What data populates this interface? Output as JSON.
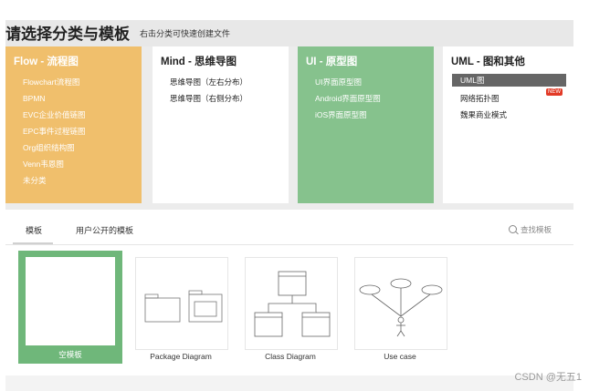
{
  "header": {
    "title": "请选择分类与模板",
    "subtitle": "右击分类可快速创建文件"
  },
  "categories": [
    {
      "title": "Flow - 流程图",
      "items": [
        "Flowchart流程图",
        "BPMN",
        "EVC企业价值链图",
        "EPC事件过程链图",
        "Org组织结构图",
        "Venn韦恩图",
        "未分类"
      ]
    },
    {
      "title": "Mind - 思维导图",
      "items": [
        "思维导图（左右分布）",
        "思维导图（右侧分布）"
      ]
    },
    {
      "title": "UI - 原型图",
      "items": [
        "UI界面原型图",
        "Android界面原型图",
        "iOS界面原型图"
      ]
    },
    {
      "title": "UML - 图和其他",
      "items": [
        "UML图",
        "网络拓扑图",
        "魏果商业模式"
      ],
      "badge": "NEW"
    }
  ],
  "tabs": [
    "模板",
    "用户公开的模板"
  ],
  "search": {
    "label": "查找模板"
  },
  "templates": [
    "空模板",
    "Package Diagram",
    "Class Diagram",
    "Use case"
  ],
  "watermark": "CSDN @无五1",
  "colors": {
    "flow": "#f0bf6c",
    "ui": "#86c28d",
    "selected": "#6fb77a"
  }
}
